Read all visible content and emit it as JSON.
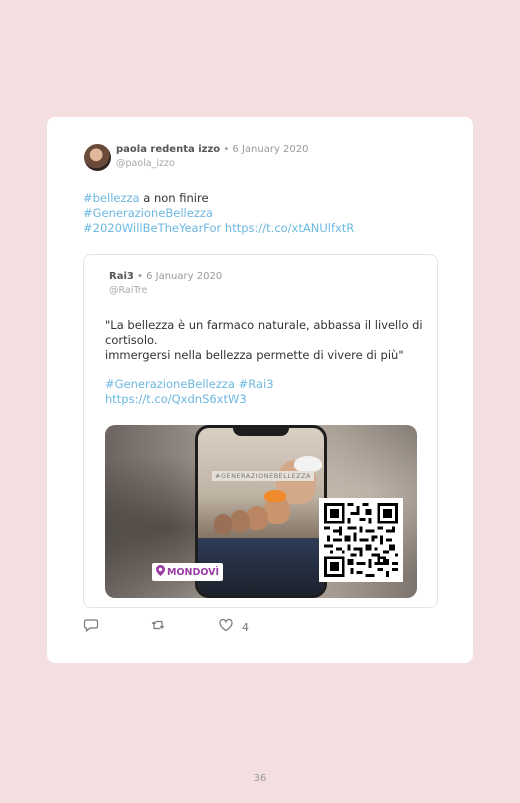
{
  "tweet": {
    "author_name": "paola redenta izzo",
    "date": " • 6 January 2020",
    "handle": "@paola_izzo",
    "text_lines": [
      {
        "link": "#bellezza",
        "rest": " a non finire"
      },
      {
        "link": "#GenerazioneBellezza",
        "rest": ""
      },
      {
        "link": "#2020WillBeTheYearFor https://t.co/xtANUlfxtR",
        "rest": ""
      }
    ]
  },
  "quoted": {
    "author_name": "Rai3",
    "date": " • 6 January 2020",
    "handle": "@RaiTre",
    "text": "\"La bellezza è un farmaco naturale, abbassa il livello di cortisolo.\nimmergersi nella bellezza permette di vivere di più\"",
    "hashtags": "#GenerazioneBellezza #Rai3",
    "link": "https://t.co/QxdnS6xtW3",
    "media": {
      "phone_tag": "#GENERAZIONEBELLEZZA",
      "location": "MONDOVÌ"
    }
  },
  "actions": {
    "reply_icon": "reply-icon",
    "retweet_icon": "retweet-icon",
    "like_icon": "heart-icon",
    "like_count": "4"
  },
  "page_number": "36"
}
